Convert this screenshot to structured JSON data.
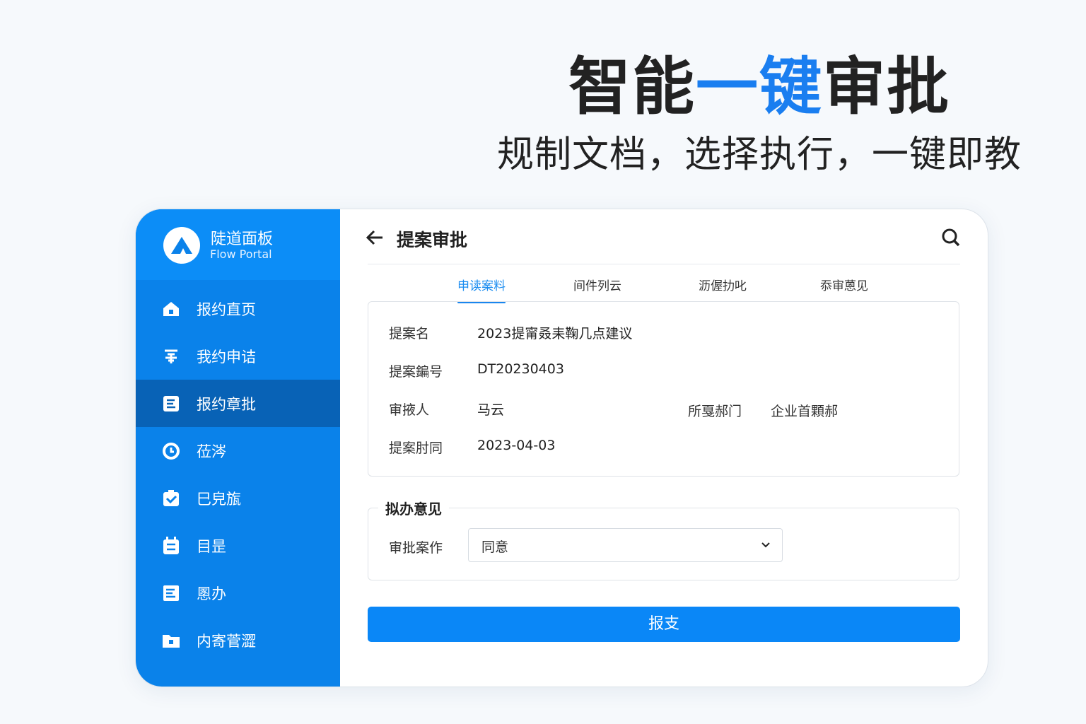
{
  "hero": {
    "title_a": "智能",
    "title_accent": "一键",
    "title_b": "审批",
    "subtitle": "规制文档，选择执行，一键即教"
  },
  "colors": {
    "accent": "#1a7ef0",
    "sidebar": "#0a82ea",
    "sidebar_active": "#0862b6",
    "button": "#0a87f7"
  },
  "sidebar": {
    "brand_name": "陡道面板",
    "brand_sub": "Flow Portal",
    "items": [
      {
        "label": "报约直页",
        "icon": "home-icon"
      },
      {
        "label": "我约申诘",
        "icon": "request-icon"
      },
      {
        "label": "报约章批",
        "icon": "document-icon",
        "active": true
      },
      {
        "label": "莅涔",
        "icon": "clock-icon"
      },
      {
        "label": "巳皃旊",
        "icon": "clipboard-check-icon"
      },
      {
        "label": "目昰",
        "icon": "calendar-icon"
      },
      {
        "label": "慁办",
        "icon": "note-icon"
      },
      {
        "label": "内寄菅澀",
        "icon": "folder-icon"
      }
    ]
  },
  "main": {
    "title": "提案审批",
    "tabs": [
      {
        "label": "申读案料",
        "active": true
      },
      {
        "label": "间件列云"
      },
      {
        "label": "沥偓扐叱"
      },
      {
        "label": "忝审蒽见"
      }
    ],
    "fields": [
      {
        "label": "提案名",
        "value": "2023提甯叒耒鞠几点建议"
      },
      {
        "label": "提案鍽号",
        "value": "DT20230403"
      },
      {
        "label": "审掖人",
        "value": "马云"
      },
      {
        "label": "提案肘同",
        "value": "2023-04-03"
      }
    ],
    "dept": {
      "label": "所戛郝门",
      "value": "企业首顆郝"
    },
    "opinion": {
      "legend": "拟办意见",
      "label": "审批案作",
      "selected": "同意"
    },
    "submit": "报支"
  }
}
